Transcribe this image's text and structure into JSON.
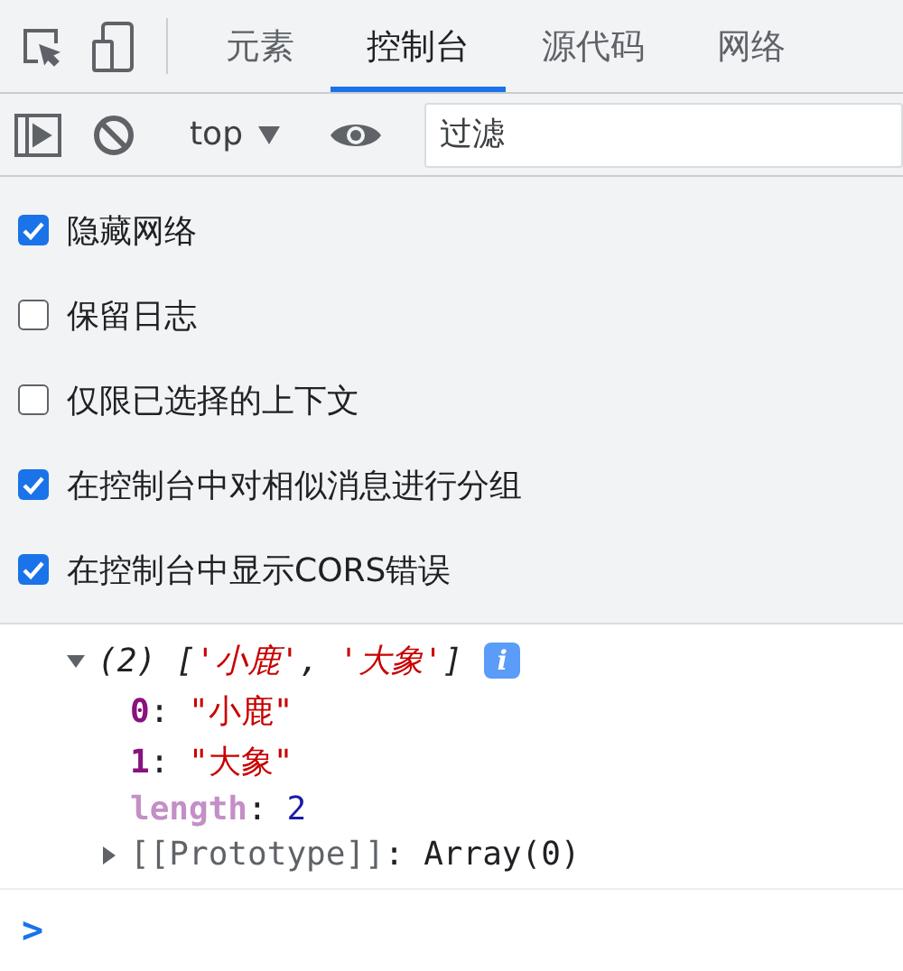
{
  "tabs": [
    {
      "label": "元素",
      "selected": false
    },
    {
      "label": "控制台",
      "selected": true
    },
    {
      "label": "源代码",
      "selected": false
    },
    {
      "label": "网络",
      "selected": false
    }
  ],
  "toolbar": {
    "context": "top",
    "filter": {
      "placeholder": "过滤"
    }
  },
  "settings": [
    {
      "label": "隐藏网络",
      "checked": true
    },
    {
      "label": "保留日志",
      "checked": false
    },
    {
      "label": "仅限已选择的上下文",
      "checked": false
    },
    {
      "label": "在控制台中对相似消息进行分组",
      "checked": true
    },
    {
      "label": "在控制台中显示CORS错误",
      "checked": true
    }
  ],
  "console": {
    "entry": {
      "expanded": true,
      "summary": [
        {
          "kind": "punct",
          "text": "(2) ["
        },
        {
          "kind": "string",
          "text": "'小鹿'"
        },
        {
          "kind": "punct",
          "text": ", "
        },
        {
          "kind": "string",
          "text": "'大象'"
        },
        {
          "kind": "punct",
          "text": "]"
        }
      ],
      "badge": "i",
      "properties": [
        {
          "kind": "index",
          "key": "0",
          "sep": ": ",
          "value": {
            "kind": "string",
            "text": "\"小鹿\""
          }
        },
        {
          "kind": "index",
          "key": "1",
          "sep": ": ",
          "value": {
            "kind": "string",
            "text": "\"大象\""
          }
        },
        {
          "kind": "hidden",
          "key": "length",
          "sep": ": ",
          "value": {
            "kind": "number",
            "text": "2"
          }
        }
      ],
      "prototype": {
        "expanded": false,
        "key": "[[Prototype]]",
        "sep": ": ",
        "value": "Array(0)"
      }
    },
    "prompt": ">"
  }
}
